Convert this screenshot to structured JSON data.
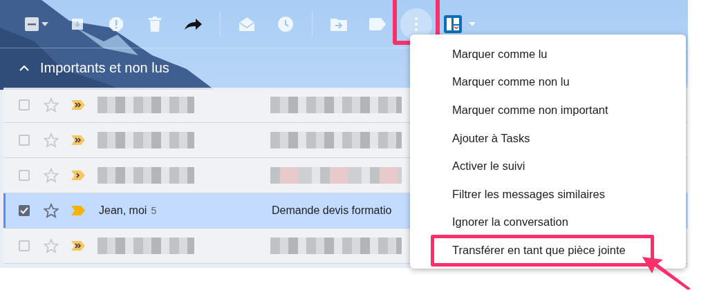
{
  "toolbar": {
    "items": [
      {
        "kind": "select"
      },
      {
        "kind": "archive"
      },
      {
        "kind": "spam"
      },
      {
        "kind": "delete"
      },
      {
        "kind": "forward"
      },
      {
        "kind": "separator"
      },
      {
        "kind": "mark-read"
      },
      {
        "kind": "snooze"
      },
      {
        "kind": "separator"
      },
      {
        "kind": "move"
      },
      {
        "kind": "label"
      },
      {
        "kind": "more",
        "highlighted": true
      },
      {
        "kind": "addon"
      }
    ]
  },
  "section": {
    "title": "Importants et non lus",
    "expanded": true
  },
  "rows": [
    {
      "selected": false,
      "starred": false,
      "marker": {
        "kind": "double"
      },
      "redacted": true
    },
    {
      "selected": false,
      "starred": false,
      "marker": {
        "kind": "double"
      },
      "redacted": true
    },
    {
      "selected": false,
      "starred": false,
      "marker": {
        "kind": "single"
      },
      "redacted": true,
      "highlight": true
    },
    {
      "selected": true,
      "starred": false,
      "marker": {
        "kind": "plain"
      },
      "redacted": false,
      "sender": "Jean, moi",
      "count": "5",
      "subject": "Demande devis formatio"
    },
    {
      "selected": false,
      "starred": false,
      "marker": {
        "kind": "double"
      },
      "redacted": true
    }
  ],
  "menu": {
    "items": [
      {
        "label": "Marquer comme lu"
      },
      {
        "label": "Marquer comme non lu"
      },
      {
        "label": "Marquer comme non important"
      },
      {
        "label": "Ajouter à Tasks"
      },
      {
        "label": "Activer le suivi"
      },
      {
        "label": "Filtrer les messages similaires"
      },
      {
        "label": "Ignorer la conversation"
      },
      {
        "label": "Transférer en tant que pièce jointe",
        "highlighted": true
      }
    ]
  }
}
